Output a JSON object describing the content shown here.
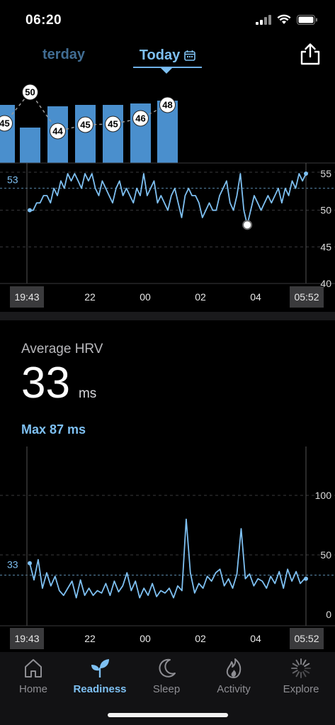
{
  "status": {
    "time": "06:20"
  },
  "date_nav": {
    "prev_label": "terday",
    "current_label": "Today"
  },
  "top_chart": {
    "type": "line",
    "bar_values": [
      45,
      null,
      44,
      45,
      45,
      46,
      48
    ],
    "trend_badges": [
      45,
      50,
      44,
      45,
      45,
      46,
      48
    ],
    "y_ticks": [
      "55",
      "50",
      "45",
      "40"
    ],
    "avg_label": "53",
    "x_ticks": [
      "19:43",
      "22",
      "00",
      "02",
      "04",
      "05:52"
    ]
  },
  "hrv": {
    "title": "Average HRV",
    "value": "33",
    "unit": "ms",
    "max_label": "Max 87 ms"
  },
  "hrv_chart": {
    "type": "line",
    "y_ticks": [
      "100",
      "50",
      "0"
    ],
    "avg_label": "33",
    "x_ticks": [
      "19:43",
      "22",
      "00",
      "02",
      "04",
      "05:52"
    ],
    "ylim": [
      0,
      110
    ]
  },
  "chart_data": [
    {
      "type": "line",
      "x": [
        "19:43",
        "22",
        "00",
        "02",
        "04",
        "05:52"
      ],
      "y_range": [
        40,
        55
      ],
      "avg": 53,
      "series": [
        {
          "values": [
            50,
            50,
            51,
            51,
            52,
            52,
            51,
            53,
            52,
            54,
            53,
            55,
            54,
            55,
            54,
            53,
            55,
            54,
            55,
            53,
            52,
            54,
            53,
            52,
            51,
            53,
            54,
            52,
            53,
            52,
            51,
            53,
            52,
            55,
            52,
            53,
            54,
            51,
            52,
            51,
            50,
            52,
            53,
            51,
            49,
            52,
            53,
            52,
            52,
            51,
            49,
            50,
            51,
            50,
            50,
            52,
            53,
            54,
            51,
            50,
            52,
            55,
            50,
            48,
            50,
            52,
            51,
            50,
            51,
            52,
            51,
            52,
            53,
            51,
            53,
            52,
            54,
            53,
            55,
            54,
            55
          ]
        }
      ]
    },
    {
      "type": "line",
      "x": [
        "19:43",
        "22",
        "00",
        "02",
        "04",
        "05:52"
      ],
      "ylim": [
        0,
        110
      ],
      "avg": 33,
      "series": [
        {
          "values": [
            43,
            29,
            46,
            22,
            35,
            24,
            32,
            20,
            16,
            22,
            28,
            14,
            29,
            16,
            22,
            16,
            20,
            18,
            26,
            16,
            28,
            19,
            24,
            35,
            20,
            28,
            14,
            22,
            16,
            26,
            15,
            20,
            18,
            22,
            14,
            24,
            20,
            80,
            35,
            18,
            26,
            22,
            32,
            28,
            35,
            38,
            24,
            30,
            22,
            34,
            72,
            30,
            34,
            24,
            30,
            28,
            22,
            32,
            26,
            36,
            22,
            38,
            28,
            36,
            26,
            30
          ]
        }
      ]
    }
  ],
  "tabs": [
    {
      "label": "Home",
      "icon": "house-icon"
    },
    {
      "label": "Readiness",
      "icon": "sprout-icon"
    },
    {
      "label": "Sleep",
      "icon": "moon-icon"
    },
    {
      "label": "Activity",
      "icon": "flame-icon"
    },
    {
      "label": "Explore",
      "icon": "spinner-icon"
    }
  ],
  "colors": {
    "accent": "#7ec0f2",
    "bar": "#4a8fcd",
    "background": "#000000"
  }
}
